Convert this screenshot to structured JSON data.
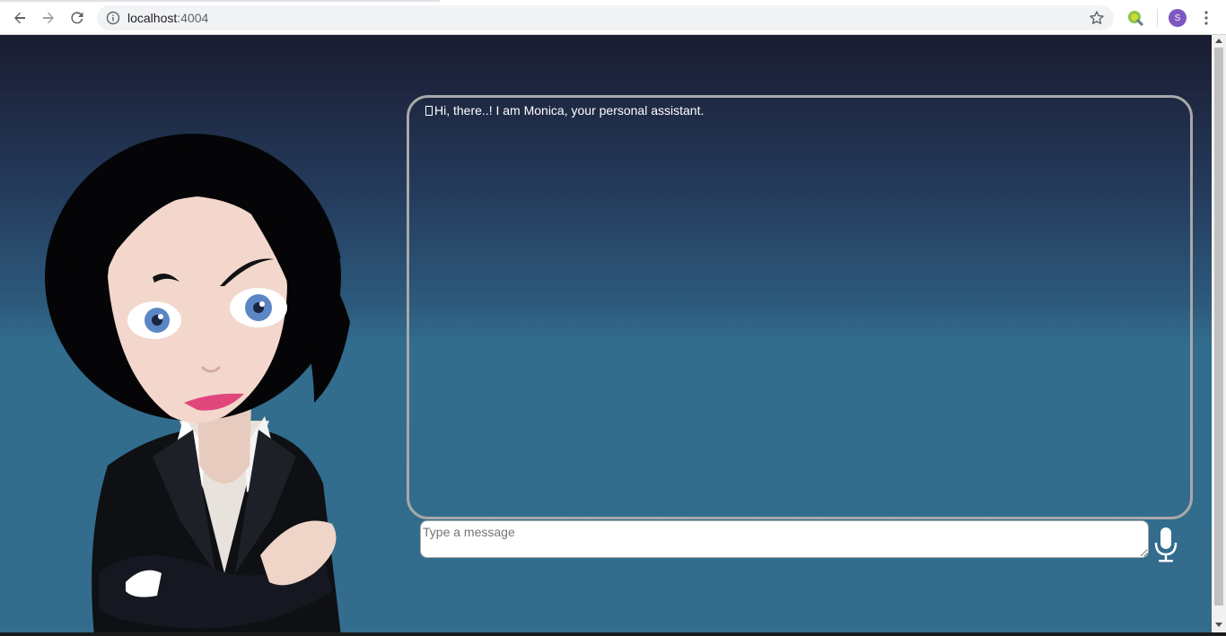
{
  "browser": {
    "url_host": "localhost",
    "url_port": ":4004",
    "profile_initial": "S"
  },
  "chat": {
    "greeting": "Hi, there..! I am Monica, your personal assistant."
  },
  "input": {
    "placeholder": "Type a message"
  },
  "icons": {
    "back": "back-arrow-icon",
    "forward": "forward-arrow-icon",
    "reload": "reload-icon",
    "info": "info-icon",
    "bookmark": "star-icon",
    "extension": "extension-icon",
    "menu": "kebab-menu-icon",
    "mic": "microphone-icon"
  },
  "colors": {
    "page_top": "#1a1c30",
    "page_bottom": "#336c8c",
    "chat_border": "#a8a8a8",
    "avatar_bg": "#7e57c2"
  }
}
